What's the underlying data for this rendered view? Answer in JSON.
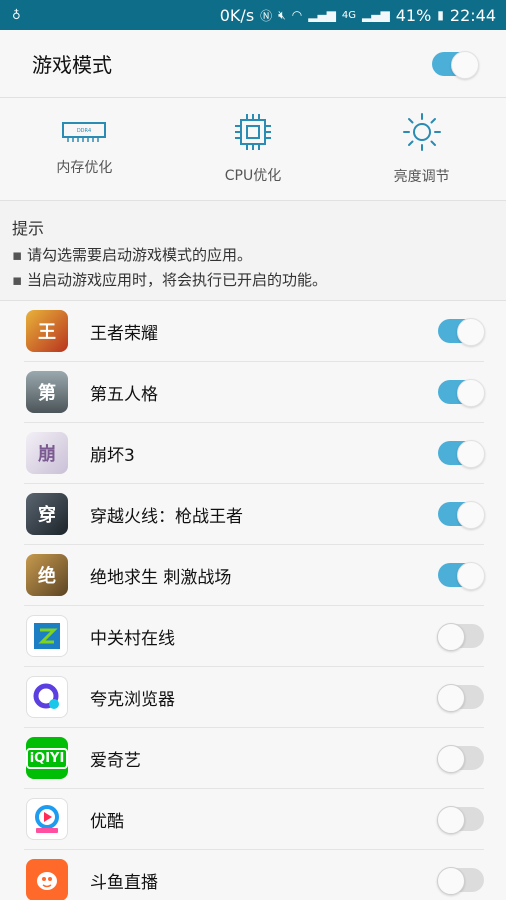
{
  "status_bar": {
    "net_speed": "0K/s",
    "battery": "41%",
    "time": "22:44",
    "network_type": "4G"
  },
  "header": {
    "title": "游戏模式",
    "toggle_on": true
  },
  "features": [
    {
      "label": "内存优化",
      "icon": "ram-chip-icon"
    },
    {
      "label": "CPU优化",
      "icon": "cpu-chip-icon"
    },
    {
      "label": "亮度调节",
      "icon": "brightness-sun-icon"
    }
  ],
  "tips": {
    "title": "提示",
    "lines": [
      "请勾选需要启动游戏模式的应用。",
      "当启动游戏应用时，将会执行已开启的功能。"
    ]
  },
  "apps": [
    {
      "name": "王者荣耀",
      "on": true,
      "color": "#c8432b"
    },
    {
      "name": "第五人格",
      "on": true,
      "color": "#6b7a80"
    },
    {
      "name": "崩坏3",
      "on": true,
      "color": "#e9e4ef"
    },
    {
      "name": "穿越火线：枪战王者",
      "on": true,
      "color": "#2f3a44"
    },
    {
      "name": "绝地求生 刺激战场",
      "on": true,
      "color": "#8a6a3a"
    },
    {
      "name": "中关村在线",
      "on": false,
      "color": "#1c7fc4"
    },
    {
      "name": "夸克浏览器",
      "on": false,
      "color": "#6a4de0"
    },
    {
      "name": "爱奇艺",
      "on": false,
      "color": "#00be06"
    },
    {
      "name": "优酷",
      "on": false,
      "color": "#1e9cf0"
    },
    {
      "name": "斗鱼直播",
      "on": false,
      "color": "#ff6a2a"
    }
  ]
}
